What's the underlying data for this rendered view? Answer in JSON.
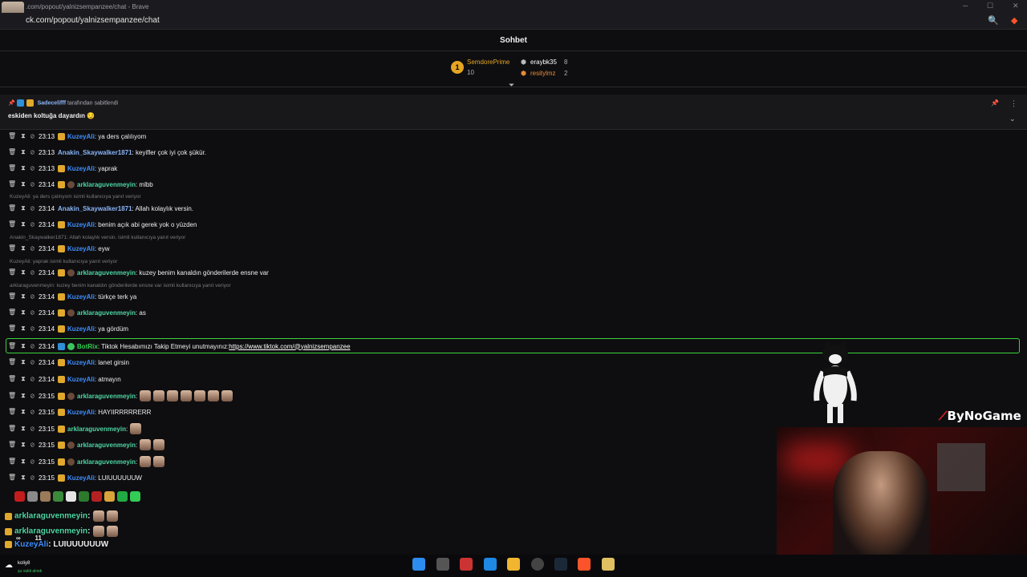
{
  "browser": {
    "title": ".com/popout/yalnizsempanzee/chat - Brave",
    "url": "ck.com/popout/yalnizsempanzee/chat"
  },
  "chat": {
    "header": "Sohbet",
    "leaderboard": {
      "first": {
        "rank": "1",
        "name": "SemdorePrime",
        "count": "10"
      },
      "second": {
        "name": "eraybk35",
        "count": "8"
      },
      "third": {
        "name": "resitylmz",
        "count": "2"
      }
    },
    "pinned": {
      "pinned_by": "Sadecelifff",
      "pinned_suffix": "tarafından sabitlendi",
      "message": "eskiden koltuğa dayardın 😏"
    },
    "messages": [
      {
        "time": "23:13",
        "user": "KuzeyAli",
        "color": "blue",
        "text": ": ya ders çalılıyom"
      },
      {
        "time": "23:13",
        "user": "Anakin_Skaywalker1871",
        "color": "sky",
        "text": ": keyifler çok iyi çok şükür."
      },
      {
        "time": "23:13",
        "user": "KuzeyAli",
        "color": "blue",
        "text": ": yaprak"
      },
      {
        "time": "23:14",
        "user": "arklaraguvenmeyin",
        "color": "green",
        "text": ": mlbb"
      },
      {
        "time": "23:14",
        "user": "Anakin_Skaywalker1871",
        "color": "sky",
        "text": ": Allah kolaylık versin."
      },
      {
        "time": "23:14",
        "user": "KuzeyAli",
        "color": "blue",
        "text": ": benim açık abi gerek yok o yüzden"
      },
      {
        "time": "23:14",
        "user": "KuzeyAli",
        "color": "blue",
        "text": ": eyw"
      },
      {
        "time": "23:14",
        "user": "arklaraguvenmeyin",
        "color": "green",
        "text": ": kuzey benim kanaldın gönderilerde ensne var"
      },
      {
        "time": "23:14",
        "user": "KuzeyAli",
        "color": "blue",
        "text": ": türkçe terk ya"
      },
      {
        "time": "23:14",
        "user": "arklaraguvenmeyin",
        "color": "green",
        "text": ": as"
      },
      {
        "time": "23:14",
        "user": "KuzeyAli",
        "color": "blue",
        "text": ": ya gördüm"
      },
      {
        "time": "23:14",
        "user": "KuzeyAli",
        "color": "blue",
        "text": ": lanet girsin"
      },
      {
        "time": "23:14",
        "user": "KuzeyAli",
        "color": "blue",
        "text": ": atmayın"
      },
      {
        "time": "23:15",
        "user": "arklaraguvenmeyin",
        "color": "green",
        "text": ":"
      },
      {
        "time": "23:15",
        "user": "KuzeyAli",
        "color": "blue",
        "text": ": HAYIIRRRRRERR"
      },
      {
        "time": "23:15",
        "user": "arklaraguvenmeyin",
        "color": "green",
        "text": ":"
      },
      {
        "time": "23:15",
        "user": "arklaraguvenmeyin",
        "color": "green",
        "text": ":"
      },
      {
        "time": "23:15",
        "user": "arklaraguvenmeyin",
        "color": "green",
        "text": ":"
      },
      {
        "time": "23:15",
        "user": "KuzeyAli",
        "color": "blue",
        "text": ": LUIUUUUUUW"
      }
    ],
    "replies": [
      "KuzeyAli: ya ders çalılıyom isimli kullanıcıya yanıt veriyor",
      "Anakin_Skaywalker1871: Allah kolaylık versin. isimli kullanıcıya yanıt veriyor",
      "KuzeyAli: yaprak isimli kullanıcıya yanıt veriyor",
      "arklaraguvenmeyin: kuzey benim kanaldın gönderilerde ensne var isimli kullanıcıya yanıt veriyor"
    ],
    "bot": {
      "time": "23:14",
      "user": "BotRix",
      "text": ": Tiktok Hesabımızı Takip Etmeyi unutmayınız: ",
      "link": "https://www.tiktok.com/@yalnizsempanzee"
    }
  },
  "overlay": {
    "line1_user": "arklaraguvenmeyin",
    "line1_sep": ":",
    "line2_user": "arklaraguvenmeyin",
    "line2_sep": ":",
    "line3_user": "KuzeyAli",
    "line3_text": ": LUIUUUUUUW",
    "viewer_count": "11",
    "brand": "ByNoGame"
  },
  "taskbar": {
    "user": "koliy8",
    "status": "şu vakti alındı"
  }
}
